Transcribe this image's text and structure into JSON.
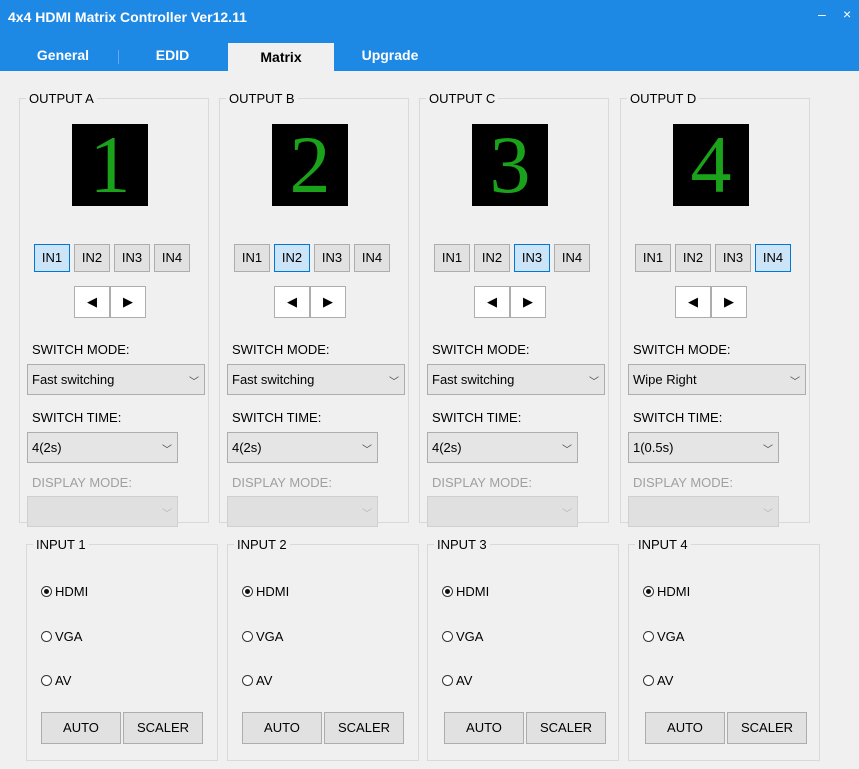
{
  "window": {
    "title": "4x4 HDMI Matrix Controller Ver12.11",
    "minimize_label": "–",
    "close_label": "×"
  },
  "tabs": [
    "General",
    "EDID",
    "Matrix",
    "Upgrade"
  ],
  "active_tab": "Matrix",
  "labels": {
    "switch_mode": "SWITCH MODE:",
    "switch_time": "SWITCH TIME:",
    "display_mode": "DISPLAY MODE:"
  },
  "outputs": [
    {
      "legend": "OUTPUT A",
      "display": "1",
      "inputs": [
        "IN1",
        "IN2",
        "IN3",
        "IN4"
      ],
      "selected_input": "IN1",
      "switch_mode": "Fast switching",
      "switch_time": "4(2s)",
      "display_mode": ""
    },
    {
      "legend": "OUTPUT B",
      "display": "2",
      "inputs": [
        "IN1",
        "IN2",
        "IN3",
        "IN4"
      ],
      "selected_input": "IN2",
      "switch_mode": "Fast switching",
      "switch_time": "4(2s)",
      "display_mode": ""
    },
    {
      "legend": "OUTPUT C",
      "display": "3",
      "inputs": [
        "IN1",
        "IN2",
        "IN3",
        "IN4"
      ],
      "selected_input": "IN3",
      "switch_mode": "Fast switching",
      "switch_time": "4(2s)",
      "display_mode": ""
    },
    {
      "legend": "OUTPUT D",
      "display": "4",
      "inputs": [
        "IN1",
        "IN2",
        "IN3",
        "IN4"
      ],
      "selected_input": "IN4",
      "switch_mode": "Wipe Right",
      "switch_time": "1(0.5s)",
      "display_mode": ""
    }
  ],
  "nav": {
    "prev": "◀",
    "next": "▶"
  },
  "input_groups": [
    {
      "legend": "INPUT 1",
      "options": [
        "HDMI",
        "VGA",
        "AV"
      ],
      "selected": "HDMI",
      "auto_label": "AUTO",
      "scaler_label": "SCALER"
    },
    {
      "legend": "INPUT 2",
      "options": [
        "HDMI",
        "VGA",
        "AV"
      ],
      "selected": "HDMI",
      "auto_label": "AUTO",
      "scaler_label": "SCALER"
    },
    {
      "legend": "INPUT 3",
      "options": [
        "HDMI",
        "VGA",
        "AV"
      ],
      "selected": "HDMI",
      "auto_label": "AUTO",
      "scaler_label": "SCALER"
    },
    {
      "legend": "INPUT 4",
      "options": [
        "HDMI",
        "VGA",
        "AV"
      ],
      "selected": "HDMI",
      "auto_label": "AUTO",
      "scaler_label": "SCALER"
    }
  ],
  "colors": {
    "titlebar": "#1e88e5",
    "display_digit": "#1aa21a",
    "display_bg": "#000000",
    "selected_button": "#cce4f7",
    "selected_border": "#0078d7"
  },
  "icons": {
    "dropdown": "chevron-down-icon",
    "prev": "left-triangle-icon",
    "next": "right-triangle-icon"
  }
}
